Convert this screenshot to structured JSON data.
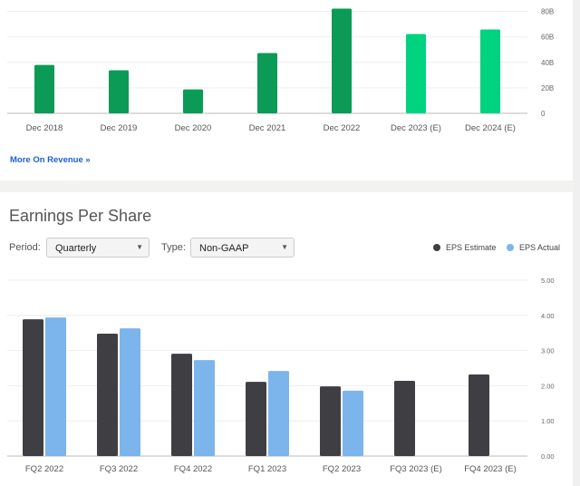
{
  "revenue_link": "More On Revenue »",
  "eps": {
    "title": "Earnings Per Share",
    "period_label": "Period:",
    "period_value": "Quarterly",
    "type_label": "Type:",
    "type_value": "Non-GAAP"
  },
  "chart_data": [
    {
      "type": "bar",
      "categories": [
        "Dec 2018",
        "Dec 2019",
        "Dec 2020",
        "Dec 2021",
        "Dec 2022",
        "Dec 2023 (E)",
        "Dec 2024 (E)"
      ],
      "values": [
        38,
        33.8,
        18.8,
        47.3,
        82.1,
        62.2,
        65.8
      ],
      "estimate": [
        false,
        false,
        false,
        false,
        false,
        true,
        true
      ],
      "yticks": [
        "0",
        "20B",
        "40B",
        "60B",
        "80B"
      ],
      "ylim": [
        0,
        80
      ],
      "grid": true,
      "colors": {
        "actual": "#0b9b56",
        "estimate": "#00d37f"
      }
    },
    {
      "type": "bar",
      "categories": [
        "FQ2 2022",
        "FQ3 2022",
        "FQ4 2022",
        "FQ1 2023",
        "FQ2 2023",
        "FQ3 2023 (E)",
        "FQ4 2023 (E)"
      ],
      "series": [
        {
          "name": "EPS Estimate",
          "color": "#3f3e42",
          "values": [
            3.89,
            3.48,
            2.91,
            2.11,
            1.98,
            2.14,
            2.32
          ]
        },
        {
          "name": "EPS Actual",
          "color": "#7cb4ec",
          "values": [
            3.94,
            3.63,
            2.73,
            2.42,
            1.86,
            null,
            null
          ]
        }
      ],
      "yticks": [
        "0.00",
        "1.00",
        "2.00",
        "3.00",
        "4.00",
        "5.00"
      ],
      "ylim": [
        0,
        5
      ],
      "grid": true,
      "legend": "top-right"
    }
  ]
}
